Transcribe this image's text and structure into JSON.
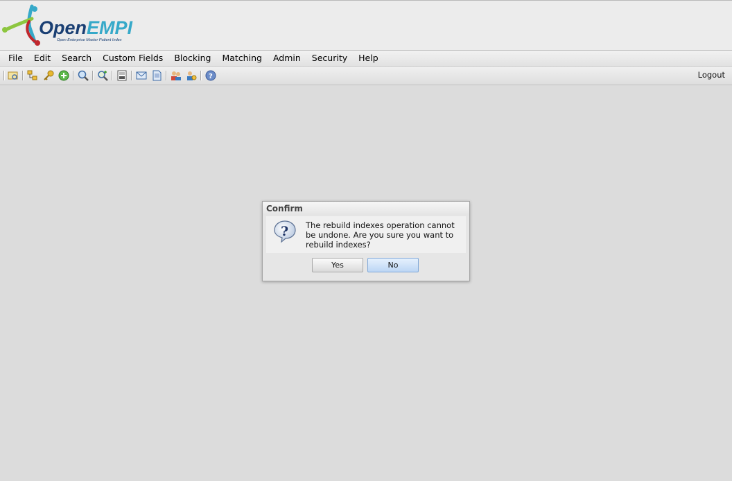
{
  "logo": {
    "title": "OpenEMPI",
    "title_part1": "Open",
    "title_part2": "EMPI",
    "subtitle": "Open Enterprise Master Patient Index"
  },
  "menu": [
    "File",
    "Edit",
    "Search",
    "Custom Fields",
    "Blocking",
    "Matching",
    "Admin",
    "Security",
    "Help"
  ],
  "toolbar": {
    "icons": [
      "browse-icon",
      "blocking-tree-icon",
      "key-icon",
      "add-icon",
      "search-icon",
      "advanced-search-icon",
      "report-icon",
      "mail-icon",
      "document-icon",
      "users-icon",
      "user-config-icon",
      "help-icon"
    ],
    "logout_label": "Logout"
  },
  "dialog": {
    "title": "Confirm",
    "message": "The rebuild indexes operation cannot be undone. Are you sure you want to rebuild indexes?",
    "yes_label": "Yes",
    "no_label": "No"
  },
  "colors": {
    "background": "#dcdcdc",
    "logo_blue": "#1a3f73",
    "logo_cyan": "#36a9c9",
    "logo_red": "#c0272d",
    "logo_green": "#8dc63f"
  }
}
